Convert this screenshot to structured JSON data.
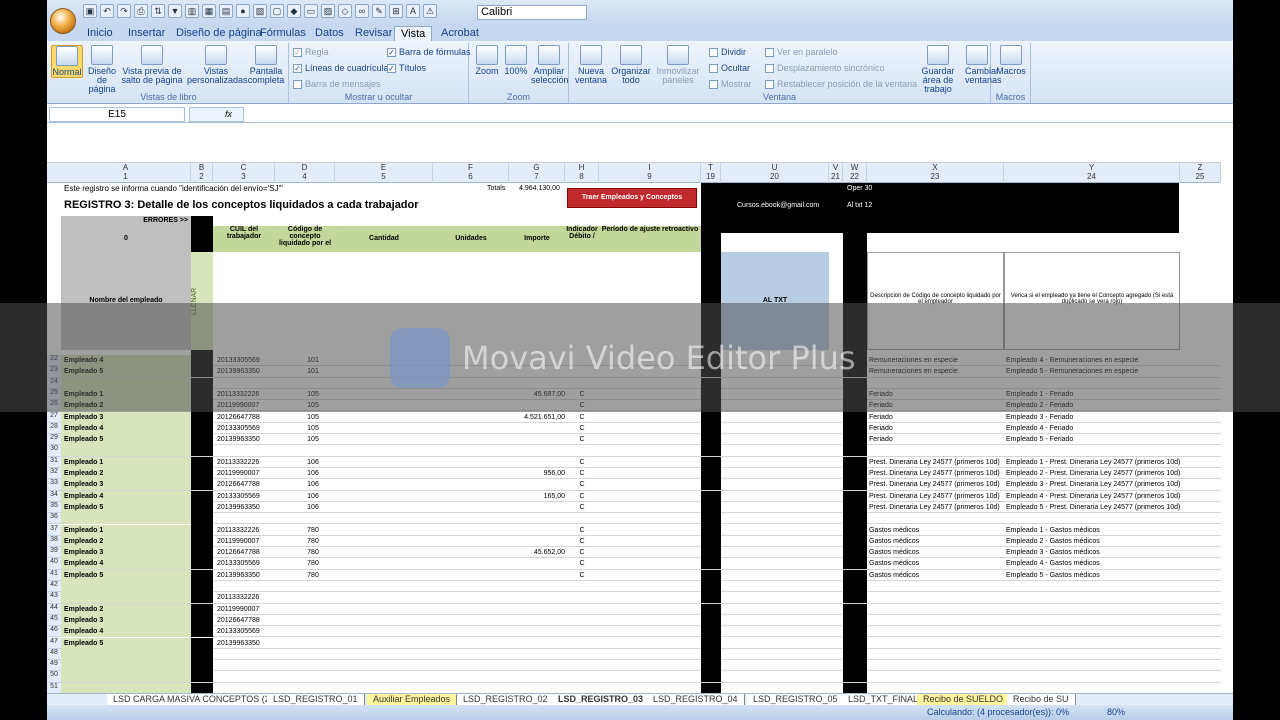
{
  "qat": {
    "font": "Calibri"
  },
  "tabs": [
    "Inicio",
    "Insertar",
    "Diseño de página",
    "Fórmulas",
    "Datos",
    "Revisar",
    "Vista",
    "Acrobat"
  ],
  "ribbon": {
    "views": {
      "normal": "Normal",
      "page_layout": "Diseño de página",
      "page_break": "Vista previa de salto de página",
      "custom": "Vistas personalizadas",
      "full": "Pantalla completa",
      "label": "Vistas de libro"
    },
    "show": {
      "ruler": "Regla",
      "gridlines": "Líneas de cuadrícula",
      "msgbar": "Barra de mensajes",
      "formulabar": "Barra de fórmulas",
      "headings": "Títulos",
      "label": "Mostrar u ocultar"
    },
    "zoom": {
      "zoom": "Zoom",
      "pct": "100%",
      "sel": "Ampliar selección",
      "label": "Zoom"
    },
    "window": {
      "new": "Nueva ventana",
      "arrange": "Organizar todo",
      "freeze": "Inmovilizar paneles",
      "split": "Dividir",
      "hide": "Ocultar",
      "show": "Mostrar",
      "side": "Ver en paralelo",
      "sync": "Desplazamiento sincrónico",
      "reset": "Restablecer posición de la ventana",
      "save": "Guardar área de trabajo",
      "switch": "Cambiar ventanas",
      "label": "Ventana"
    },
    "macros": {
      "macros": "Macros",
      "label": "Macros"
    }
  },
  "namebox": "E15",
  "sheet": {
    "row2": "Este registro se informa cuando \"identificación del envío='SJ'\"",
    "total_label": "Totals",
    "total_value": "4.964.130,00",
    "title": "REGISTRO 3: Detalle de los conceptos liquidados a cada trabajador",
    "button": "Traer Empleados y Conceptos",
    "email": "Cursos.ebook@gmail.com",
    "oper": "Oper  30",
    "altxt": "Al txt  12",
    "errores": "ERRORES >>",
    "headers": {
      "cuil": "CUIL del trabajador",
      "codigo": "Código de concepto liquidado por el",
      "cantidad": "Cantidad",
      "unidades": "Unidades",
      "importe": "Importe",
      "indicador": "Indicador Débito /",
      "periodo": "Período de ajuste retroactivo",
      "nombre": "Nombre del empleado",
      "llenar": "LLENAR",
      "altxt": "AL TXT",
      "desc": "Descripcion de Código de concepto liquidado por el empleador",
      "verifica": "Verica si el empleado ya tiene el Concepto agregado (Si está duplicado se vera rojo)"
    },
    "rows": [
      {
        "n": "22",
        "name": "Empleado 4",
        "cuil": "20133305569",
        "cod": "101",
        "imp": "",
        "ind": "",
        "desc": "Remuneraciones en especie",
        "ver": "Empleado 4 - Remuneraciones en especie"
      },
      {
        "n": "23",
        "name": "Empleado 5",
        "cuil": "20139963350",
        "cod": "101",
        "imp": "",
        "ind": "",
        "desc": "Remuneraciones en especie",
        "ver": "Empleado 5 - Remuneraciones en especie"
      },
      {
        "n": "24",
        "name": "",
        "cuil": "",
        "cod": "",
        "imp": "",
        "ind": "",
        "desc": "",
        "ver": ""
      },
      {
        "n": "25",
        "name": "Empleado 1",
        "cuil": "20113332226",
        "cod": "105",
        "imp": "45.687,00",
        "ind": "C",
        "desc": "Feriado",
        "ver": "Empleado 1 - Feriado"
      },
      {
        "n": "26",
        "name": "Empleado 2",
        "cuil": "20119990007",
        "cod": "105",
        "imp": "",
        "ind": "C",
        "desc": "Feriado",
        "ver": "Empleado 2 - Feriado"
      },
      {
        "n": "27",
        "name": "Empleado 3",
        "cuil": "20126647788",
        "cod": "105",
        "imp": "4.521.651,00",
        "ind": "C",
        "desc": "Feriado",
        "ver": "Empleado 3 - Feriado"
      },
      {
        "n": "28",
        "name": "Empleado 4",
        "cuil": "20133305569",
        "cod": "105",
        "imp": "",
        "ind": "C",
        "desc": "Feriado",
        "ver": "Empleado 4 - Feriado"
      },
      {
        "n": "29",
        "name": "Empleado 5",
        "cuil": "20139963350",
        "cod": "105",
        "imp": "",
        "ind": "C",
        "desc": "Feriado",
        "ver": "Empleado 5 - Feriado"
      },
      {
        "n": "30",
        "name": "",
        "cuil": "",
        "cod": "",
        "imp": "",
        "ind": "",
        "desc": "",
        "ver": ""
      },
      {
        "n": "31",
        "name": "Empleado 1",
        "cuil": "20113332226",
        "cod": "106",
        "imp": "",
        "ind": "C",
        "desc": "Prest. Dineraria Ley 24577 (primeros 10d)",
        "ver": "Empleado 1 - Prest. Dineraria Ley 24577 (primeros 10d)"
      },
      {
        "n": "32",
        "name": "Empleado 2",
        "cuil": "20119990007",
        "cod": "106",
        "imp": "956,00",
        "ind": "C",
        "desc": "Prest. Dineraria Ley 24577 (primeros 10d)",
        "ver": "Empleado 2 - Prest. Dineraria Ley 24577 (primeros 10d)"
      },
      {
        "n": "33",
        "name": "Empleado 3",
        "cuil": "20126647788",
        "cod": "106",
        "imp": "",
        "ind": "C",
        "desc": "Prest. Dineraria Ley 24577 (primeros 10d)",
        "ver": "Empleado 3 - Prest. Dineraria Ley 24577 (primeros 10d)"
      },
      {
        "n": "34",
        "name": "Empleado 4",
        "cuil": "20133305569",
        "cod": "106",
        "imp": "165,00",
        "ind": "C",
        "desc": "Prest. Dineraria Ley 24577 (primeros 10d)",
        "ver": "Empleado 4 - Prest. Dineraria Ley 24577 (primeros 10d)"
      },
      {
        "n": "35",
        "name": "Empleado 5",
        "cuil": "20139963350",
        "cod": "106",
        "imp": "",
        "ind": "C",
        "desc": "Prest. Dineraria Ley 24577 (primeros 10d)",
        "ver": "Empleado 5 - Prest. Dineraria Ley 24577 (primeros 10d)"
      },
      {
        "n": "36",
        "name": "",
        "cuil": "",
        "cod": "",
        "imp": "",
        "ind": "",
        "desc": "",
        "ver": ""
      },
      {
        "n": "37",
        "name": "Empleado 1",
        "cuil": "20113332226",
        "cod": "780",
        "imp": "",
        "ind": "C",
        "desc": "Gastos médicos",
        "ver": "Empleado 1 - Gastos médicos"
      },
      {
        "n": "38",
        "name": "Empleado 2",
        "cuil": "20119990007",
        "cod": "780",
        "imp": "",
        "ind": "C",
        "desc": "Gastos médicos",
        "ver": "Empleado 2 - Gastos médicos"
      },
      {
        "n": "39",
        "name": "Empleado 3",
        "cuil": "20126647788",
        "cod": "780",
        "imp": "45.652,00",
        "ind": "C",
        "desc": "Gastos médicos",
        "ver": "Empleado 3 - Gastos médicos"
      },
      {
        "n": "40",
        "name": "Empleado 4",
        "cuil": "20133305569",
        "cod": "780",
        "imp": "",
        "ind": "C",
        "desc": "Gastos médicos",
        "ver": "Empleado 4 - Gastos médicos"
      },
      {
        "n": "41",
        "name": "Empleado 5",
        "cuil": "20139963350",
        "cod": "780",
        "imp": "",
        "ind": "C",
        "desc": "Gastos médicos",
        "ver": "Empleado 5 - Gastos médicos"
      },
      {
        "n": "42",
        "name": "",
        "cuil": "",
        "cod": "",
        "imp": "",
        "ind": "",
        "desc": "",
        "ver": ""
      },
      {
        "n": "43",
        "name": "",
        "cuil": "20113332226",
        "cod": "",
        "imp": "",
        "ind": "",
        "desc": "",
        "ver": ""
      },
      {
        "n": "44",
        "name": "Empleado 2",
        "cuil": "20119990007",
        "cod": "",
        "imp": "",
        "ind": "",
        "desc": "",
        "ver": ""
      },
      {
        "n": "45",
        "name": "Empleado 3",
        "cuil": "20126647788",
        "cod": "",
        "imp": "",
        "ind": "",
        "desc": "",
        "ver": ""
      },
      {
        "n": "46",
        "name": "Empleado 4",
        "cuil": "20133305569",
        "cod": "",
        "imp": "",
        "ind": "",
        "desc": "",
        "ver": ""
      },
      {
        "n": "47",
        "name": "Empleado 5",
        "cuil": "20139963350",
        "cod": "",
        "imp": "",
        "ind": "",
        "desc": "",
        "ver": ""
      },
      {
        "n": "48",
        "name": "",
        "cuil": "",
        "cod": "",
        "imp": "",
        "ind": "",
        "desc": "",
        "ver": ""
      },
      {
        "n": "49",
        "name": "",
        "cuil": "",
        "cod": "",
        "imp": "",
        "ind": "",
        "desc": "",
        "ver": ""
      },
      {
        "n": "50",
        "name": "",
        "cuil": "",
        "cod": "",
        "imp": "",
        "ind": "",
        "desc": "",
        "ver": ""
      },
      {
        "n": "51",
        "name": "",
        "cuil": "",
        "cod": "",
        "imp": "",
        "ind": "",
        "desc": "",
        "ver": ""
      }
    ]
  },
  "sheet_tabs": [
    "LSD CARGA MASIVA CONCEPTOS (2)",
    "LSD_REGISTRO_01",
    "Auxiliar Empleados",
    "LSD_REGISTRO_02",
    "LSD_REGISTRO_03",
    "LSD_REGISTRO_04",
    "LSD_REGISTRO_05",
    "LSD_TXT_FINAL",
    "Recibo de SUELDO",
    "Recibo de SU"
  ],
  "status": {
    "calc": "Calculando: (4 procesador(es)): 0%",
    "zoom": "80%"
  },
  "watermark": "Movavi Video Editor Plus"
}
